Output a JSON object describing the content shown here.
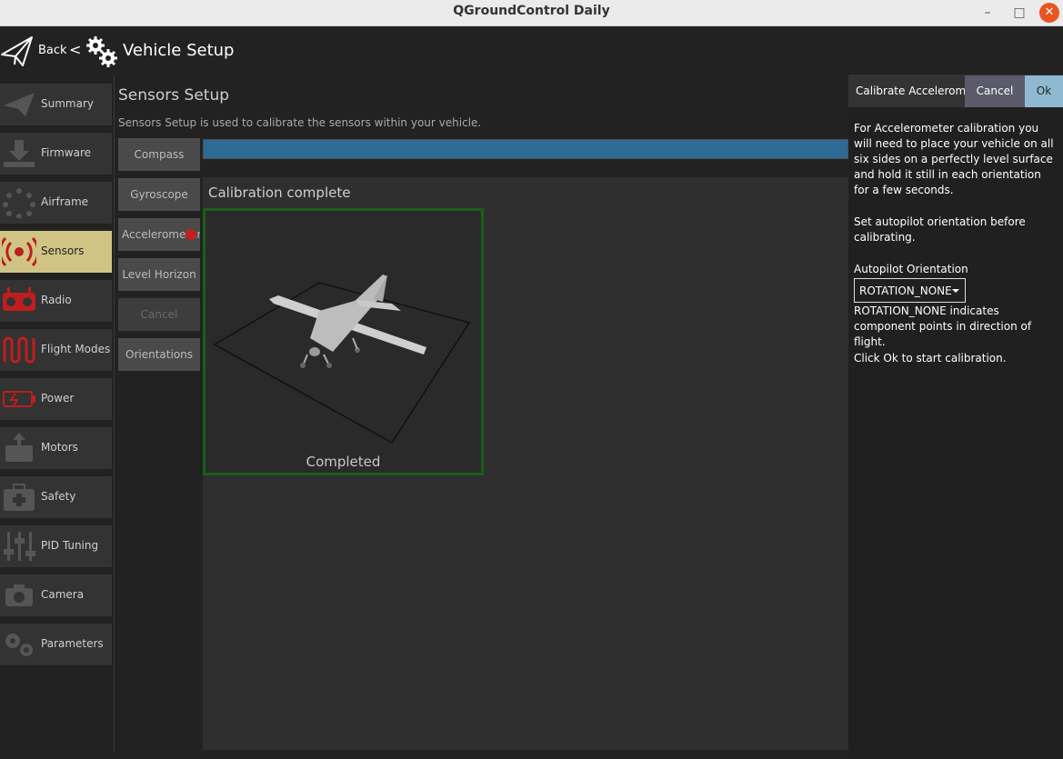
{
  "window": {
    "title": "QGroundControl Daily",
    "minimize": "–",
    "maximize": "□",
    "close": "✕"
  },
  "toolbar": {
    "back_label": "Back",
    "separator": "<",
    "title": "Vehicle Setup",
    "back_icon": "paper-plane-icon",
    "title_icon": "gears-icon"
  },
  "sidebar": {
    "items": [
      {
        "label": "Summary",
        "icon": "plane-icon",
        "active": false
      },
      {
        "label": "Firmware",
        "icon": "download-icon",
        "active": false
      },
      {
        "label": "Airframe",
        "icon": "airframe-icon",
        "active": false
      },
      {
        "label": "Sensors",
        "icon": "sensors-icon",
        "active": true
      },
      {
        "label": "Radio",
        "icon": "radio-icon",
        "active": false
      },
      {
        "label": "Flight Modes",
        "icon": "flight-modes-icon",
        "active": false
      },
      {
        "label": "Power",
        "icon": "battery-icon",
        "active": false
      },
      {
        "label": "Motors",
        "icon": "motors-icon",
        "active": false
      },
      {
        "label": "Safety",
        "icon": "safety-icon",
        "active": false
      },
      {
        "label": "PID Tuning",
        "icon": "sliders-icon",
        "active": false
      },
      {
        "label": "Camera",
        "icon": "camera-icon",
        "active": false
      },
      {
        "label": "Parameters",
        "icon": "parameters-gears-icon",
        "active": false
      }
    ],
    "active_color": "#d0c485",
    "icon_color": "#bd1e1e"
  },
  "sensors": {
    "title": "Sensors Setup",
    "description": "Sensors Setup is used to calibrate the sensors within your vehicle.",
    "buttons": [
      {
        "label": "Compass",
        "enabled": true
      },
      {
        "label": "Gyroscope",
        "enabled": true
      },
      {
        "label": "Accelerometer",
        "enabled": true
      },
      {
        "label": "Level Horizon",
        "enabled": true
      },
      {
        "label": "Cancel",
        "enabled": false
      },
      {
        "label": "Orientations",
        "enabled": true
      }
    ],
    "progress": 1.0,
    "status_title": "Calibration complete",
    "orientation_status": "Completed"
  },
  "dialog": {
    "title": "Calibrate Accelerometer",
    "cancel_label": "Cancel",
    "ok_label": "Ok",
    "para1": "For Accelerometer calibration you will need to place your vehicle on all six sides on a perfectly level surface and hold it still in each orientation for a few seconds.",
    "para2": "Set autopilot orientation before calibrating.",
    "orientation_label": "Autopilot Orientation",
    "orientation_value": "ROTATION_NONE",
    "orientation_help": "ROTATION_NONE indicates component points in direction of flight.",
    "para3": "Click Ok to start calibration."
  }
}
